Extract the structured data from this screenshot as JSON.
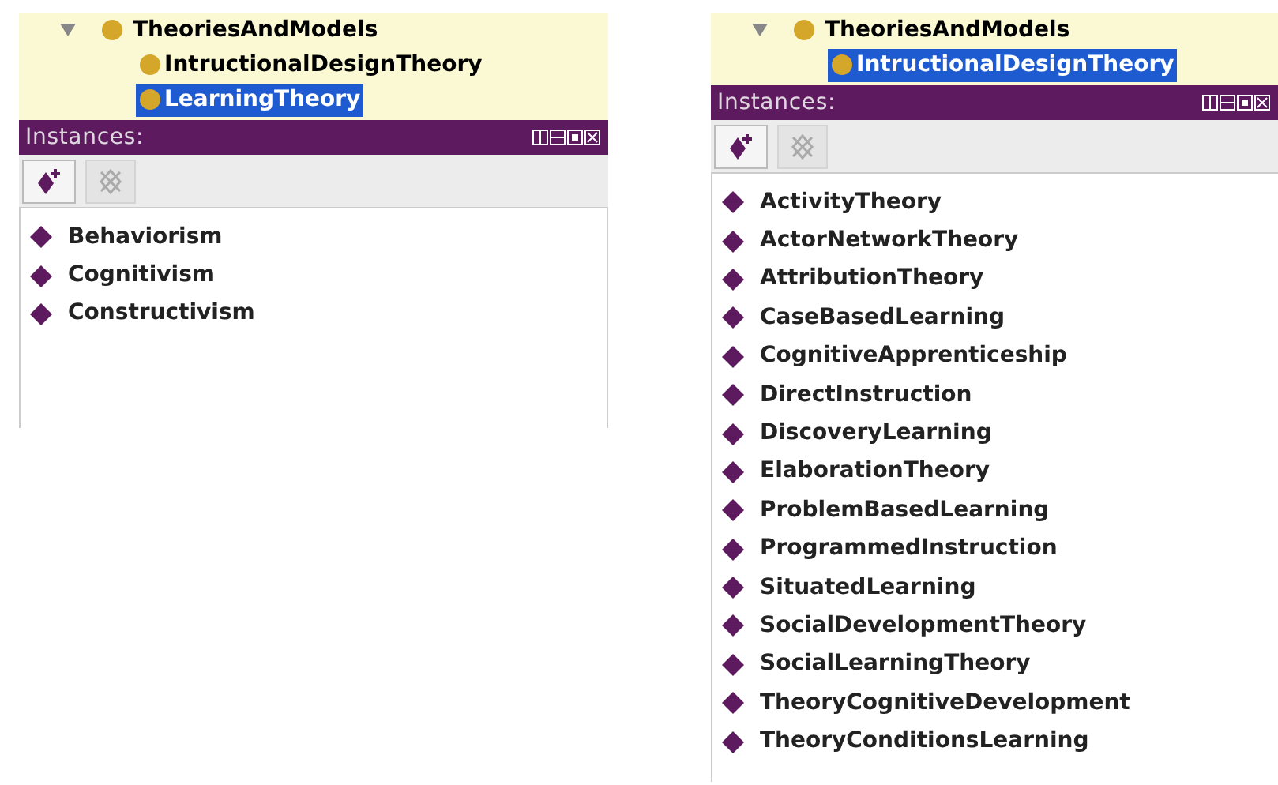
{
  "panels": [
    {
      "tree": {
        "label": "TheoriesAndModels",
        "expanded": true,
        "children": [
          {
            "label": "IntructionalDesignTheory",
            "selected": false
          },
          {
            "label": "LearningTheory",
            "selected": true
          }
        ]
      },
      "header": "Instances:",
      "instances": [
        "Behaviorism",
        "Cognitivism",
        "Constructivism"
      ]
    },
    {
      "tree": {
        "label": "TheoriesAndModels",
        "expanded": true,
        "children": [
          {
            "label": "IntructionalDesignTheory",
            "selected": true
          }
        ]
      },
      "header": "Instances:",
      "instances": [
        "ActivityTheory",
        "ActorNetworkTheory",
        "AttributionTheory",
        "CaseBasedLearning",
        "CognitiveApprenticeship",
        "DirectInstruction",
        "DiscoveryLearning",
        "ElaborationTheory",
        "ProblemBasedLearning",
        "ProgrammedInstruction",
        "SituatedLearning",
        "SocialDevelopmentTheory",
        "SocialLearningTheory",
        "TheoryCognitiveDevelopment",
        "TheoryConditionsLearning"
      ]
    }
  ]
}
